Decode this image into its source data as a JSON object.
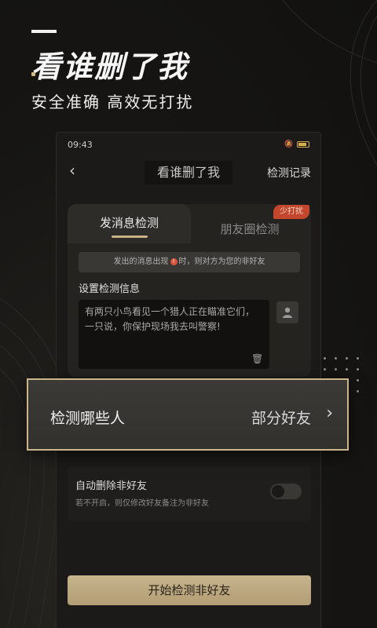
{
  "promo": {
    "headline": "看谁删了我",
    "subhead": "安全准确  高效无打扰"
  },
  "status_bar": {
    "time": "09:43"
  },
  "navbar": {
    "back_icon": "chevron-left-icon",
    "title": "看谁删了我",
    "action": "检测记录"
  },
  "tabs": [
    {
      "label": "发消息检测",
      "active": true
    },
    {
      "label": "朋友圈检测",
      "active": false,
      "badge": "少打扰"
    }
  ],
  "notice": {
    "before": "发出的消息出现",
    "icon_glyph": "!",
    "after": "时，则对方为您的非好友"
  },
  "detect_info": {
    "label": "设置检测信息",
    "message": "有两只小鸟看见一个猎人正在瞄准它们，一只说，你保护现场我去叫警察!"
  },
  "who_row": {
    "label": "检测哪些人",
    "value": "部分好友"
  },
  "auto_delete": {
    "title": "自动删除非好友",
    "desc": "若不开启，则仅修改好友备注为非好友",
    "enabled": false
  },
  "cta": {
    "label": "开始检测非好友"
  },
  "colors": {
    "accent_gold": "#cbb58a",
    "badge_red": "#c4472d",
    "battery": "#d6b04a"
  }
}
